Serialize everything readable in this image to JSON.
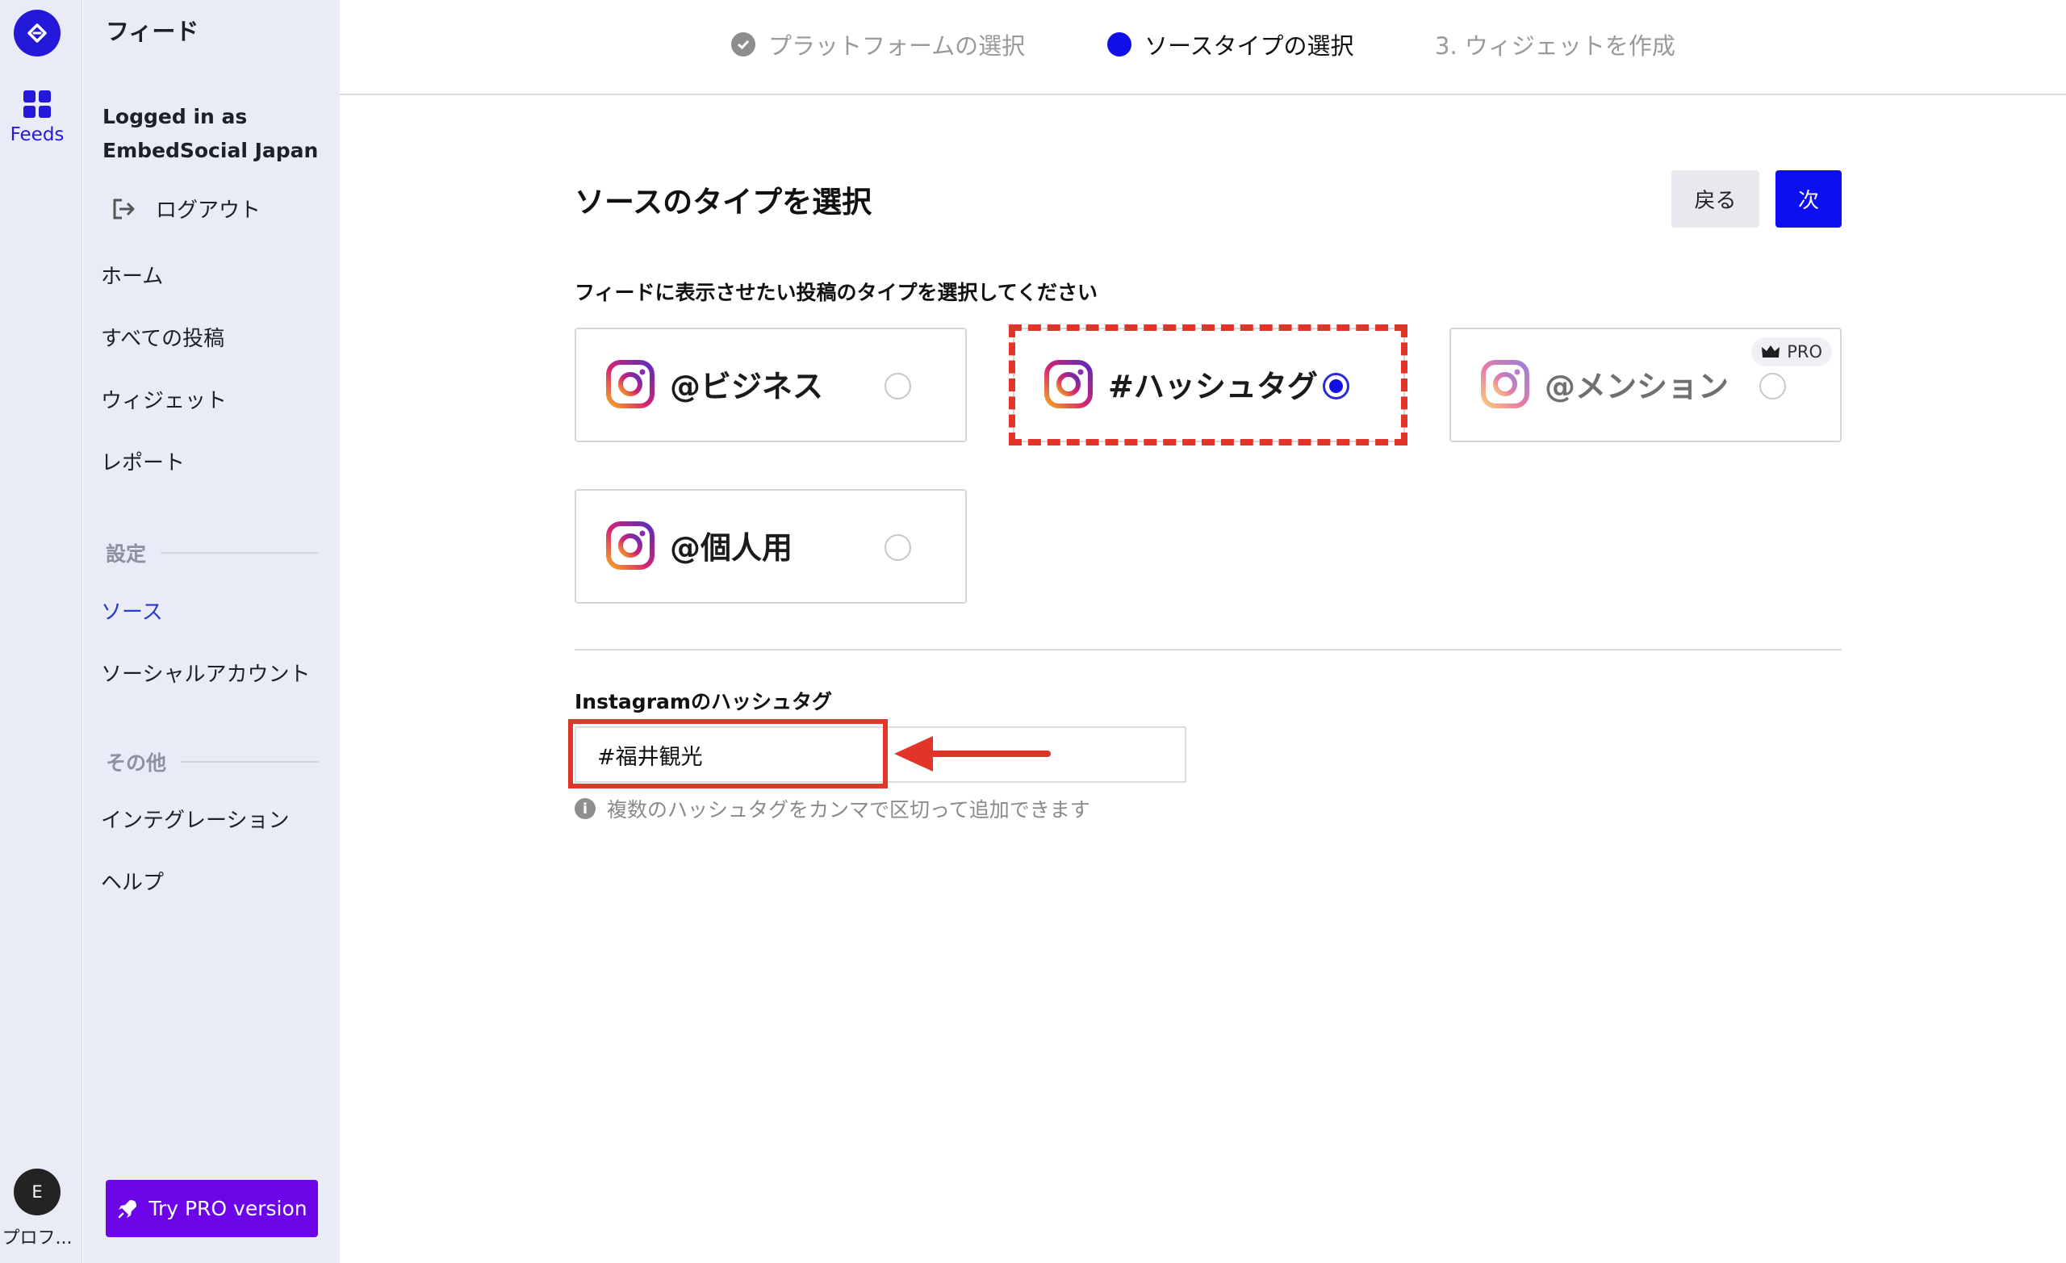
{
  "rail": {
    "feeds_label": "Feeds",
    "avatar_initial": "E",
    "profile_label": "プロフ..."
  },
  "sidebar": {
    "title": "フィード",
    "logged_in_line1": "Logged in as",
    "logged_in_line2": "EmbedSocial Japan",
    "logout_label": "ログアウト",
    "items": [
      {
        "label": "ホーム"
      },
      {
        "label": "すべての投稿"
      },
      {
        "label": "ウィジェット"
      },
      {
        "label": "レポート"
      }
    ],
    "settings_header": "設定",
    "settings_items": [
      {
        "label": "ソース",
        "active": true
      },
      {
        "label": "ソーシャルアカウント"
      }
    ],
    "other_header": "その他",
    "other_items": [
      {
        "label": "インテグレーション"
      },
      {
        "label": "ヘルプ"
      }
    ],
    "pro_button": "Try PRO version"
  },
  "stepper": {
    "steps": [
      {
        "label": "プラットフォームの選択",
        "state": "done"
      },
      {
        "label": "ソースタイプの選択",
        "state": "active"
      },
      {
        "label": "3.  ウィジェットを作成",
        "state": "todo"
      }
    ]
  },
  "main": {
    "title": "ソースのタイプを選択",
    "back_button": "戻る",
    "next_button": "次",
    "subtitle": "フィードに表示させたい投稿のタイプを選択してください",
    "options": [
      {
        "label": "@ビジネス",
        "selected": false
      },
      {
        "label": "#ハッシュタグ",
        "selected": true
      },
      {
        "label": "@メンション",
        "selected": false,
        "badge": "PRO"
      },
      {
        "label": "@個人用",
        "selected": false
      }
    ],
    "hashtag_label": "Instagramのハッシュタグ",
    "hashtag_value": "#福井観光",
    "hint": "複数のハッシュタグをカンマで区切って追加できます"
  },
  "colors": {
    "accent": "#0c0ff0",
    "pro": "#6b05e8",
    "annotation": "#e3342a",
    "sidebar_bg": "#e9ebf6"
  }
}
